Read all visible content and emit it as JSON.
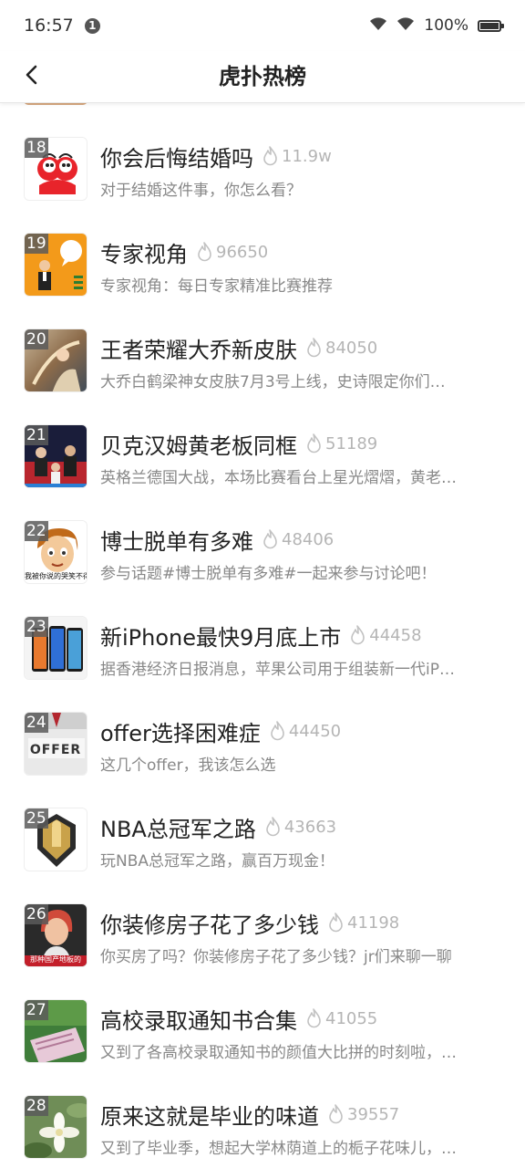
{
  "status_bar": {
    "time": "16:57",
    "notification_count": "1",
    "battery": "100%"
  },
  "nav": {
    "title": "虎扑热榜"
  },
  "items": [
    {
      "rank": "18",
      "title": "你会后悔结婚吗",
      "heat": "11.9w",
      "desc": "对于结婚这件事，你怎么看？",
      "thumb_icon": "cartoon-couple-thumbnail"
    },
    {
      "rank": "19",
      "title": "专家视角",
      "heat": "96650",
      "desc": "专家视角：每日专家精准比赛推荐",
      "thumb_icon": "expert-presenter-thumbnail"
    },
    {
      "rank": "20",
      "title": "王者荣耀大乔新皮肤",
      "heat": "84050",
      "desc": "大乔白鹤梁神女皮肤7月3号上线，史诗限定你们…",
      "thumb_icon": "game-skin-art-thumbnail"
    },
    {
      "rank": "21",
      "title": "贝克汉姆黄老板同框",
      "heat": "51189",
      "desc": "英格兰德国大战，本场比赛看台上星光熠熠，黄老…",
      "thumb_icon": "stadium-crowd-thumbnail"
    },
    {
      "rank": "22",
      "title": "博士脱单有多难",
      "heat": "48406",
      "desc": "参与话题#博士脱单有多难#一起来参与讨论吧！",
      "thumb_icon": "cartoon-face-meme-thumbnail",
      "thumb_caption": "我被你说的哭笑不得"
    },
    {
      "rank": "23",
      "title": "新iPhone最快9月底上市",
      "heat": "44458",
      "desc": "据香港经济日报消息，苹果公司用于组装新一代iP…",
      "thumb_icon": "phones-thumbnail"
    },
    {
      "rank": "24",
      "title": "offer选择困难症",
      "heat": "44450",
      "desc": "这几个offer，我该怎么选",
      "thumb_icon": "offer-card-thumbnail",
      "thumb_caption": "OFFER"
    },
    {
      "rank": "25",
      "title": "NBA总冠军之路",
      "heat": "43663",
      "desc": "玩NBA总冠军之路，赢百万现金！",
      "thumb_icon": "trophy-badge-thumbnail"
    },
    {
      "rank": "26",
      "title": "你装修房子花了多少钱",
      "heat": "41198",
      "desc": "你买房了吗？你装修房子花了多少钱？jr们来聊一聊",
      "thumb_icon": "woman-portrait-thumbnail",
      "thumb_caption": "那种国产地板的"
    },
    {
      "rank": "27",
      "title": "高校录取通知书合集",
      "heat": "41055",
      "desc": "又到了各高校录取通知书的颜值大比拼的时刻啦，…",
      "thumb_icon": "admission-letter-thumbnail"
    },
    {
      "rank": "28",
      "title": "原来这就是毕业的味道",
      "heat": "39557",
      "desc": "又到了毕业季，想起大学林荫道上的栀子花味儿，…",
      "thumb_icon": "gardenia-flower-thumbnail"
    }
  ],
  "colors": {
    "heat_gray": "#b5b5b5",
    "desc_gray": "#888888",
    "title_text": "#222222",
    "rank_badge": "#5a5a5a"
  }
}
